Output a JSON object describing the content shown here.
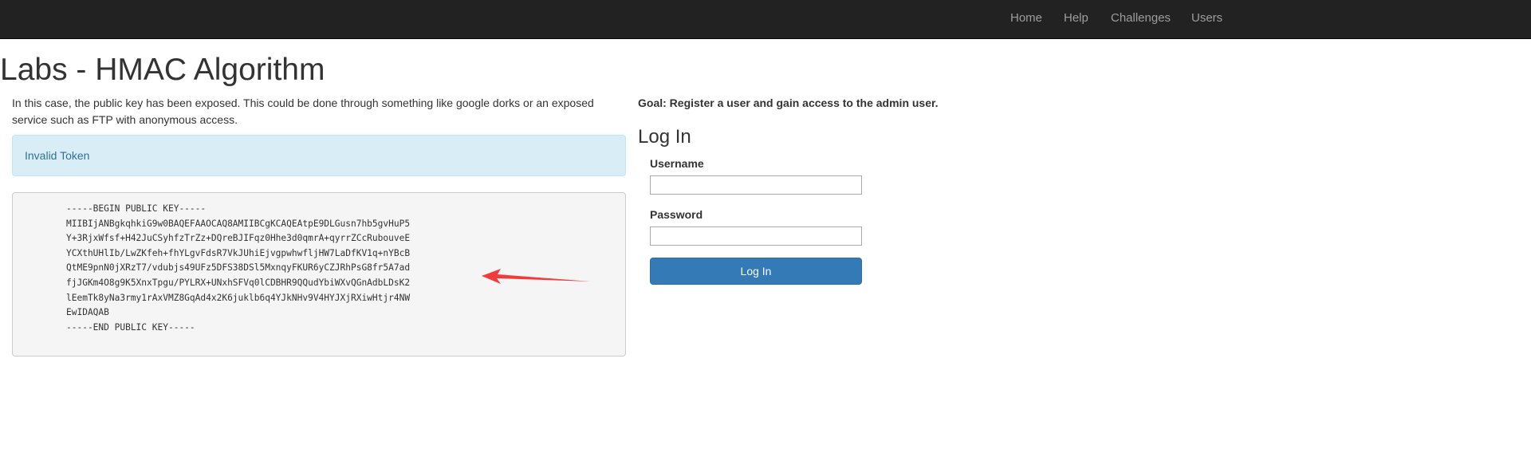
{
  "nav": {
    "items": [
      {
        "label": "Home"
      },
      {
        "label": "Help"
      },
      {
        "label": "Challenges"
      },
      {
        "label": "Users"
      }
    ]
  },
  "page": {
    "title": "Labs - HMAC Algorithm",
    "intro": "In this case, the public key has been exposed. This could be done through something like google dorks or an exposed service such as FTP with anonymous access.",
    "alert": "Invalid Token",
    "public_key": "-----BEGIN PUBLIC KEY-----\nMIIBIjANBgkqhkiG9w0BAQEFAAOCAQ8AMIIBCgKCAQEAtpE9DLGusn7hb5gvHuP5\nY+3RjxWfsf+H42JuCSyhfzTrZz+DQreBJIFqz0Hhe3d0qmrA+qyrrZCcRubouveE\nYCXthUHlIb/LwZKfeh+fhYLgvFdsR7VkJUhiEjvgpwhwfljHW7LaDfKV1q+nYBcB\nQtME9pnN0jXRzT7/vdubjs49UFz5DFS38DSl5MxnqyFKUR6yCZJRhPsG8fr5A7ad\nfjJGKm4O8g9K5XnxTpgu/PYLRX+UNxhSFVq0lCDBHR9QQudYbiWXvQGnAdbLDsK2\nlEemTk8yNa3rmy1rAxVMZ8GqAd4x2K6juklb6q4YJkNHv9V4HYJXjRXiwHtjr4NW\nEwIDAQAB\n-----END PUBLIC KEY-----"
  },
  "login": {
    "goal": "Goal: Register a user and gain access to the admin user.",
    "title": "Log In",
    "username_label": "Username",
    "username_value": "",
    "password_label": "Password",
    "password_value": "",
    "button_label": "Log In"
  },
  "colors": {
    "navbar_bg": "#222222",
    "nav_text": "#9d9d9d",
    "alert_bg": "#d9edf7",
    "alert_text": "#31708f",
    "primary": "#337ab7",
    "annotation_arrow": "#f03c3c"
  },
  "icons": {
    "annotation": "arrow-annotation-icon"
  }
}
